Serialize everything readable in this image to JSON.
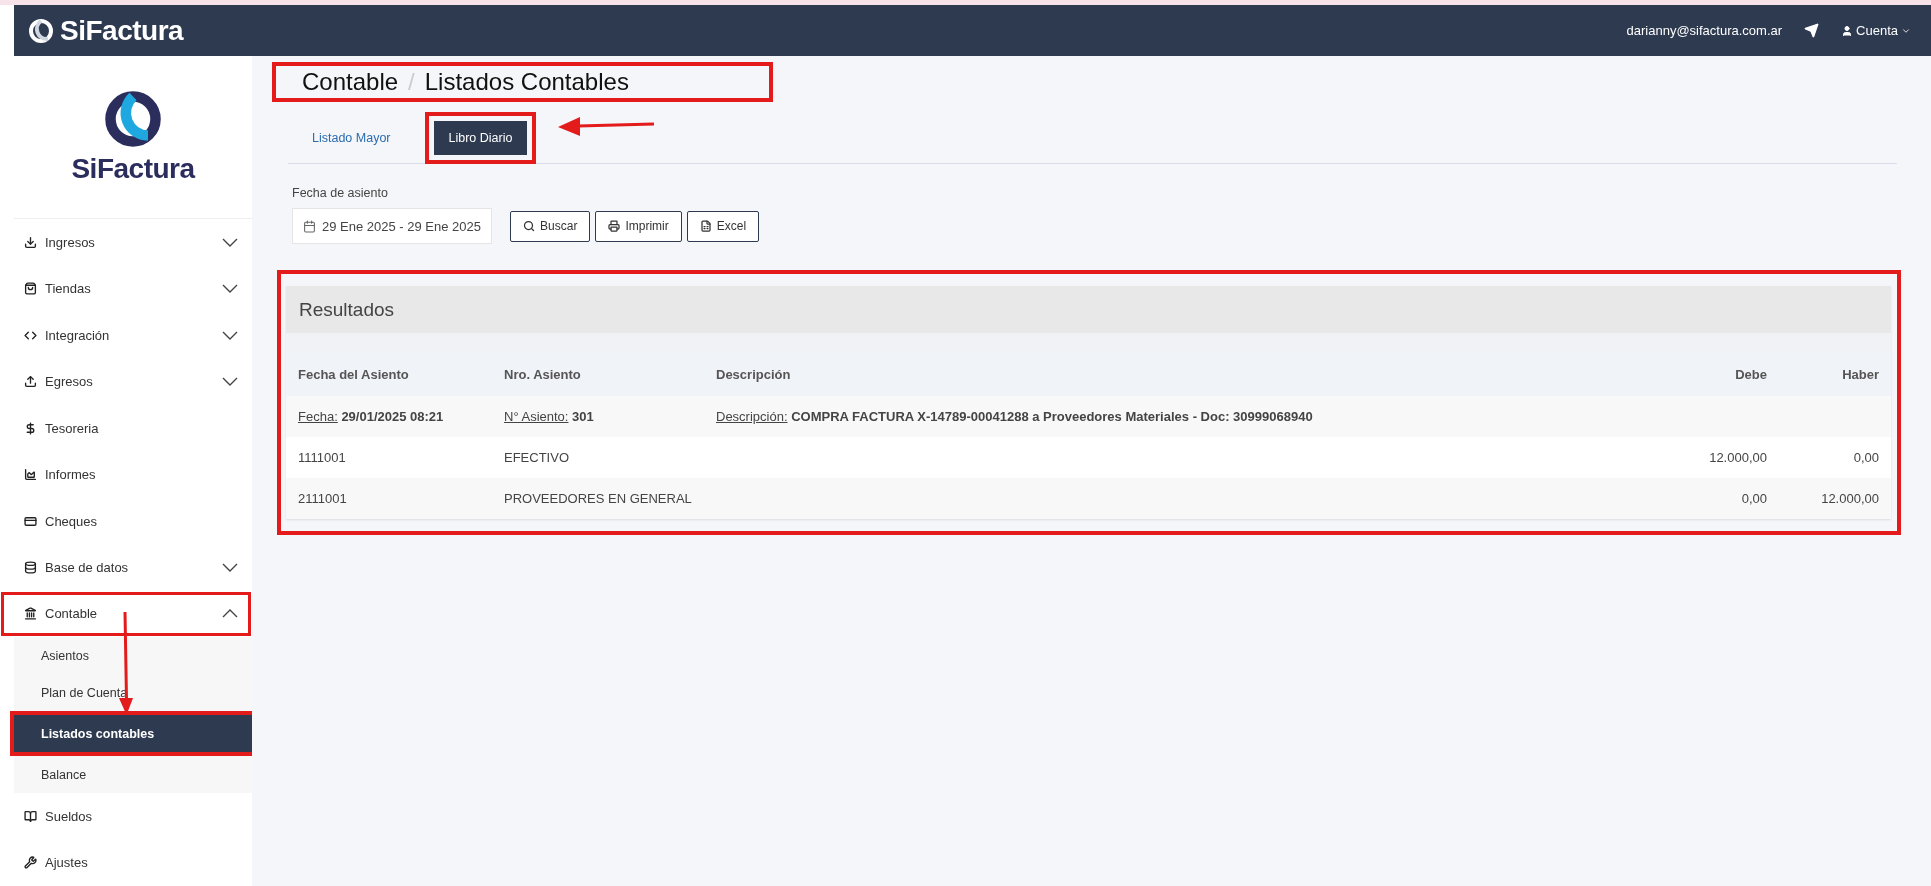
{
  "topbar": {
    "brand": "SiFactura",
    "email": "darianny@sifactura.com.ar",
    "account": "Cuenta"
  },
  "sidebar": {
    "brand": "SiFactura",
    "items": [
      {
        "label": "Ingresos",
        "expanded": false
      },
      {
        "label": "Tiendas",
        "expanded": false
      },
      {
        "label": "Integración",
        "expanded": false
      },
      {
        "label": "Egresos",
        "expanded": false
      },
      {
        "label": "Tesoreria"
      },
      {
        "label": "Informes"
      },
      {
        "label": "Cheques"
      },
      {
        "label": "Base de datos",
        "expanded": false
      },
      {
        "label": "Contable",
        "expanded": true,
        "marked": true,
        "children": [
          {
            "label": "Asientos",
            "selected": false,
            "marked": false
          },
          {
            "label": "Plan de Cuenta",
            "selected": false,
            "marked": false
          },
          {
            "label": "Listados contables",
            "selected": true,
            "marked": true
          },
          {
            "label": "Balance",
            "selected": false,
            "marked": false
          }
        ]
      },
      {
        "label": "Sueldos"
      },
      {
        "label": "Ajustes"
      }
    ]
  },
  "breadcrumb": {
    "items": [
      "Contable",
      "Listados Contables"
    ],
    "separator": "/",
    "marked": true
  },
  "tabs": [
    {
      "label": "Listado Mayor",
      "selected": false,
      "marked": false
    },
    {
      "label": "Libro Diario",
      "selected": true,
      "marked": true
    }
  ],
  "filter": {
    "label": "Fecha de asiento",
    "value": "29 Ene 2025 - 29 Ene 2025",
    "buttons": [
      "Buscar",
      "Imprimir",
      "Excel"
    ]
  },
  "results": {
    "title": "Resultados",
    "marked": true,
    "columns": [
      "Fecha del Asiento",
      "Nro. Asiento",
      "Descripción",
      "Debe",
      "Haber"
    ],
    "rows": [
      {
        "kind": "entry",
        "date_label": "Fecha:",
        "date": "29/01/2025 08:21",
        "number_label": "N° Asiento:",
        "number": "301",
        "description_label": "Descripción:",
        "description": "COMPRA FACTURA X-14789-00041288 a Proveedores Materiales - Doc: 30999068940"
      },
      {
        "kind": "line",
        "account": "1111001",
        "name": "EFECTIVO",
        "debe": "12.000,00",
        "haber": "0,00"
      },
      {
        "kind": "line",
        "account": "2111001",
        "name": "PROVEEDORES EN GENERAL",
        "debe": "0,00",
        "haber": "12.000,00"
      }
    ]
  }
}
